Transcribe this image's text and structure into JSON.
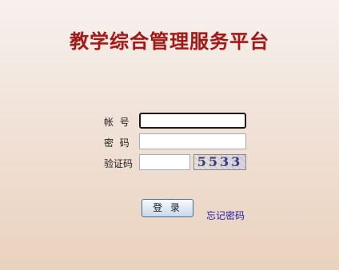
{
  "page": {
    "title": "教学综合管理服务平台"
  },
  "form": {
    "account_label": "帐  号",
    "account_value": "",
    "password_label": "密  码",
    "password_value": "",
    "captcha_label": "验证码",
    "captcha_value": "",
    "captcha_text": "5533"
  },
  "actions": {
    "login_label": "登 录",
    "forgot_label": "忘记密码"
  },
  "colors": {
    "title": "#9e1a1a",
    "link": "#1a1aa6",
    "background_top": "#f7f1ee",
    "background_bottom": "#ead2bd"
  }
}
